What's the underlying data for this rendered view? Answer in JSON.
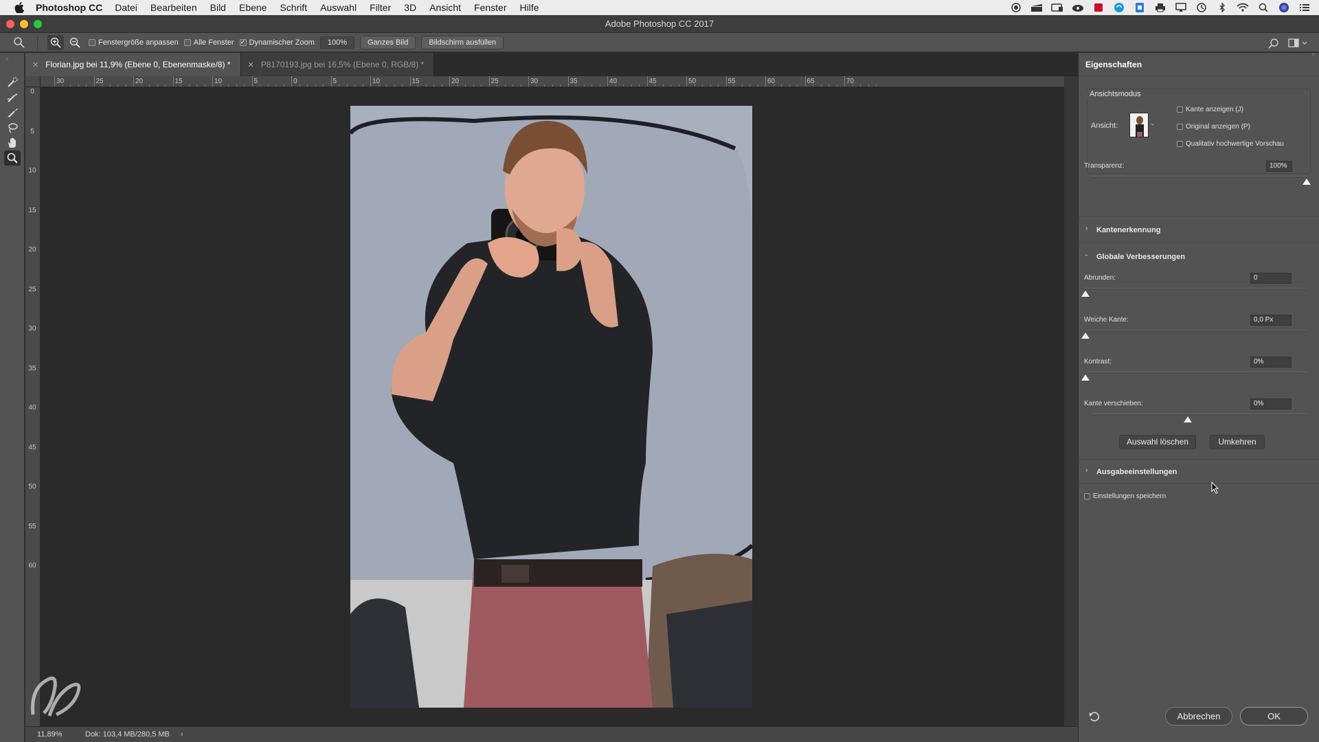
{
  "menubar": {
    "app_name": "Photoshop CC",
    "items": [
      "Datei",
      "Bearbeiten",
      "Bild",
      "Ebene",
      "Schrift",
      "Auswahl",
      "Filter",
      "3D",
      "Ansicht",
      "Fenster",
      "Hilfe"
    ]
  },
  "titlebar": {
    "title": "Adobe Photoshop CC 2017"
  },
  "options": {
    "resize_windows_label": "Fenstergröße anpassen",
    "all_windows_label": "Alle Fenster",
    "scrubby_zoom_label": "Dynamischer Zoom",
    "zoom_value": "100%",
    "fit_screen_label": "Ganzes Bild",
    "fill_screen_label": "Bildschirm ausfüllen"
  },
  "tabs": [
    {
      "label": "Florian.jpg bei 11,9% (Ebene 0, Ebenenmaske/8) *"
    },
    {
      "label": "P8170193.jpg bei 16,5% (Ebene 0, RGB/8) *"
    }
  ],
  "ruler": {
    "h_labels": [
      "30",
      "25",
      "20",
      "15",
      "10",
      "5",
      "0",
      "5",
      "10",
      "15",
      "20",
      "25",
      "30",
      "35",
      "40",
      "45",
      "50",
      "55",
      "60",
      "65",
      "70"
    ],
    "v_labels": [
      "0",
      "5",
      "10",
      "15",
      "20",
      "25",
      "30",
      "35",
      "40",
      "45",
      "50",
      "55",
      "60"
    ]
  },
  "status": {
    "zoom": "11,89%",
    "doc": "Dok: 103,4 MB/280,5 MB",
    "arrow": "›"
  },
  "panel": {
    "title": "Eigenschaften",
    "view_mode_title": "Ansichtsmodus",
    "view_label": "Ansicht:",
    "show_edge": "Kante anzeigen (J)",
    "show_original": "Original anzeigen (P)",
    "high_quality_preview": "Qualitativ hochwertige Vorschau",
    "transparency_label": "Transparenz:",
    "transparency_value": "100%",
    "edge_detection_title": "Kantenerkennung",
    "global_refinements_title": "Globale Verbesserungen",
    "smooth_label": "Abrunden:",
    "smooth_value": "0",
    "feather_label": "Weiche Kante:",
    "feather_value": "0,0 Px",
    "contrast_label": "Kontrast:",
    "contrast_value": "0%",
    "shift_edge_label": "Kante verschieben:",
    "shift_edge_value": "0%",
    "clear_selection_label": "Auswahl löschen",
    "invert_label": "Umkehren",
    "output_settings_title": "Ausgabeeinstellungen",
    "remember_settings_label": "Einstellungen speichern",
    "cancel_label": "Abbrechen",
    "ok_label": "OK",
    "sliders": {
      "transparency": 1.0,
      "smooth": 0.0,
      "feather": 0.0,
      "contrast": 0.0,
      "shift_edge": 0.5
    }
  },
  "colors": {
    "accent": "#1473e6",
    "panel_bg": "#535353",
    "canvas_bg": "#2a2a2a"
  }
}
